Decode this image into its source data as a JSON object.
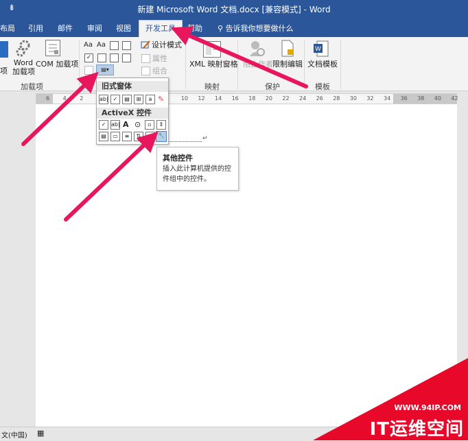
{
  "window": {
    "title": "新建 Microsoft Word 文档.docx [兼容模式]  -  Word"
  },
  "tabs": [
    {
      "label": "布局"
    },
    {
      "label": "引用"
    },
    {
      "label": "邮件"
    },
    {
      "label": "审阅"
    },
    {
      "label": "视图"
    },
    {
      "label": "开发工具"
    },
    {
      "label": "帮助"
    }
  ],
  "tell_me": {
    "placeholder": "告诉我你想要做什么"
  },
  "ribbon": {
    "addins_group": {
      "label": "加载项",
      "word_addins": "Word\n加载项",
      "word_addins_cut": "项",
      "com_addins": "COM 加载项"
    },
    "controls_group": {
      "design_mode": "设计模式",
      "properties": "属性",
      "group": "组合"
    },
    "mapping_group": {
      "label": "映射",
      "xml_pane": "XML 映射窗格"
    },
    "protect_group": {
      "label": "保护",
      "block_authors": "阻止作者",
      "restrict_editing": "限制编辑"
    },
    "templates_group": {
      "label": "模板",
      "doc_template": "文档模板"
    }
  },
  "ruler": {
    "ticks": [
      "6",
      "4",
      "2",
      "",
      "2",
      "4",
      "6",
      "8",
      "10",
      "12",
      "14",
      "16",
      "18",
      "20",
      "22",
      "24",
      "26",
      "28",
      "30",
      "32",
      "34",
      "36",
      "38",
      "40",
      "42"
    ]
  },
  "dropdown": {
    "legacy_header": "旧式窗体",
    "activex_header": "ActiveX 控件"
  },
  "tooltip": {
    "title": "其他控件",
    "body": "插入此计算机提供的控件组中的控件。"
  },
  "status": {
    "language": "文(中国)"
  },
  "watermark": {
    "url": "WWW.94IP.COM",
    "brand": "IT运维空间"
  },
  "colors": {
    "accent": "#2b579a",
    "arrow": "#e8175d",
    "watermark": "#e8082a"
  }
}
